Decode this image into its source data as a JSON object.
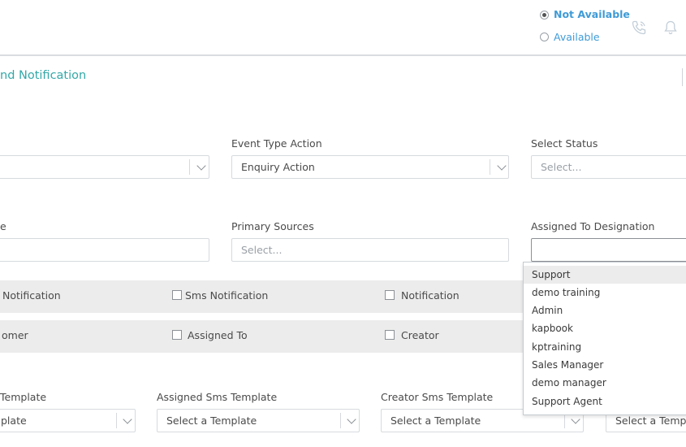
{
  "header": {
    "status_options": [
      {
        "label": "Not Available",
        "selected": true
      },
      {
        "label": "Available",
        "selected": false
      }
    ],
    "icons": [
      "phone-icon",
      "bell-icon"
    ]
  },
  "page": {
    "title": "nd Notification"
  },
  "row1": {
    "first_field_value": "",
    "event_type_action": {
      "label": "Event Type Action",
      "value": "Enquiry Action"
    },
    "select_status": {
      "label": "Select Status",
      "placeholder": "Select..."
    }
  },
  "row2": {
    "first_label_fragment": "e",
    "primary_sources": {
      "label": "Primary Sources",
      "placeholder": "Select..."
    },
    "assigned_to_designation": {
      "label": "Assigned To Designation",
      "value": ""
    }
  },
  "notify_row": {
    "items": [
      "Notification",
      "Sms Notification",
      "Notification"
    ]
  },
  "recipient_row": {
    "items": [
      "omer",
      "Assigned To",
      "Creator"
    ]
  },
  "templates": {
    "labels": [
      "Template",
      "Assigned Sms Template",
      "Creator Sms Template"
    ],
    "values": [
      "plate",
      "Select a Template",
      "Select a Template",
      "Select a Templa"
    ]
  },
  "designation_dropdown": {
    "options": [
      "Support",
      "demo training",
      "Admin",
      "kapbook",
      "kptraining",
      "Sales Manager",
      "demo manager",
      "Support Agent"
    ],
    "highlighted_index": 0
  },
  "colors": {
    "accent_blue": "#3f9bd7",
    "title_teal": "#33a8a8",
    "row_grey": "#ececec"
  }
}
